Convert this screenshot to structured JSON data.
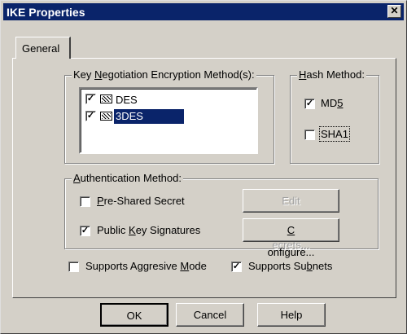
{
  "window": {
    "title": "IKE Properties",
    "close_glyph": "✕"
  },
  "tab": {
    "label": "General"
  },
  "encryption": {
    "group_label_pre": "Key ",
    "group_label_u": "N",
    "group_label_post": "egotiation Encryption Method(s):",
    "items": [
      {
        "label": "DES",
        "checked": true,
        "selected": false
      },
      {
        "label": "3DES",
        "checked": true,
        "selected": true
      }
    ]
  },
  "hash": {
    "group_label_u": "H",
    "group_label_post": "ash Method:",
    "md5_pre": "MD",
    "md5_u": "5",
    "md5_checked": true,
    "sha1_label": "SHA1",
    "sha1_checked": false
  },
  "auth": {
    "group_label_pre": "",
    "group_label_u": "A",
    "group_label_post": "uthentication Method:",
    "preshared_u": "P",
    "preshared_post": "re-Shared Secret",
    "preshared_checked": false,
    "pubkey_pre": "Public ",
    "pubkey_u": "K",
    "pubkey_post": "ey Signatures",
    "pubkey_checked": true,
    "edit_secrets_pre": "Edit ",
    "edit_secrets_u": "S",
    "edit_secrets_post": "ecrets...",
    "configure_u": "C",
    "configure_post": "onfigure..."
  },
  "options": {
    "aggressive_pre": "Supports Aggresive ",
    "aggressive_u": "M",
    "aggressive_post": "ode",
    "aggressive_checked": false,
    "subnets_pre": "Supports Su",
    "subnets_u": "b",
    "subnets_post": "nets",
    "subnets_checked": true
  },
  "buttons": {
    "ok": "OK",
    "cancel": "Cancel",
    "help": "Help"
  },
  "check_glyph": "✓"
}
